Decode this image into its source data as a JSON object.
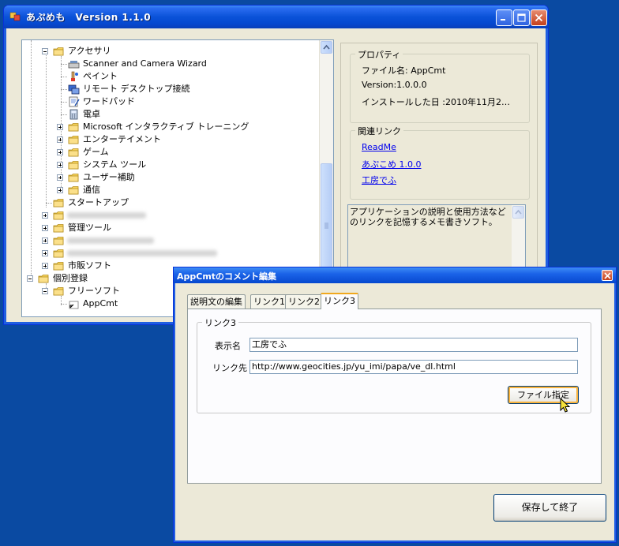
{
  "main_window": {
    "title": "あぷめも　Version 1.1.0",
    "tree": [
      {
        "label": "アクセサリ",
        "level": 1,
        "expander": "minus",
        "icon": "folder"
      },
      {
        "label": "Scanner and Camera Wizard",
        "level": 2,
        "expander": "none",
        "icon": "scanner"
      },
      {
        "label": "ペイント",
        "level": 2,
        "expander": "none",
        "icon": "paint"
      },
      {
        "label": "リモート デスクトップ接続",
        "level": 2,
        "expander": "none",
        "icon": "remote-desktop"
      },
      {
        "label": "ワードパッド",
        "level": 2,
        "expander": "none",
        "icon": "wordpad"
      },
      {
        "label": "電卓",
        "level": 2,
        "expander": "none",
        "icon": "calculator"
      },
      {
        "label": "Microsoft インタラクティブ トレーニング",
        "level": 2,
        "expander": "plus",
        "icon": "folder"
      },
      {
        "label": "エンターテイメント",
        "level": 2,
        "expander": "plus",
        "icon": "folder"
      },
      {
        "label": "ゲーム",
        "level": 2,
        "expander": "plus",
        "icon": "folder"
      },
      {
        "label": "システム ツール",
        "level": 2,
        "expander": "plus",
        "icon": "folder"
      },
      {
        "label": "ユーザー補助",
        "level": 2,
        "expander": "plus",
        "icon": "folder"
      },
      {
        "label": "通信",
        "level": 2,
        "expander": "plus",
        "icon": "folder"
      },
      {
        "label": "スタートアップ",
        "level": 1,
        "expander": "none",
        "icon": "folder"
      },
      {
        "label": "",
        "level": 1,
        "expander": "plus",
        "icon": "folder",
        "blurred": 100
      },
      {
        "label": "管理ツール",
        "level": 1,
        "expander": "plus",
        "icon": "folder"
      },
      {
        "label": "",
        "level": 1,
        "expander": "plus",
        "icon": "folder",
        "blurred": 110
      },
      {
        "label": "",
        "level": 1,
        "expander": "plus",
        "icon": "folder",
        "blurred": 190
      },
      {
        "label": "市販ソフト",
        "level": 1,
        "expander": "plus",
        "icon": "folder"
      },
      {
        "label": "個別登録",
        "level": 0,
        "expander": "minus",
        "icon": "folder"
      },
      {
        "label": "フリーソフト",
        "level": 1,
        "expander": "minus",
        "icon": "folder"
      },
      {
        "label": "AppCmt",
        "level": 2,
        "expander": "none",
        "icon": "shortcut"
      }
    ],
    "properties": {
      "legend": "プロパティ",
      "file_name": "ファイル名: AppCmt",
      "version": "Version:1.0.0.0",
      "install_date": "インストールした日 :2010年11月2…"
    },
    "links": {
      "legend": "関連リンク",
      "items": [
        "ReadMe",
        "あぷこめ 1.0.0",
        "工房でふ"
      ]
    },
    "description": "アプリケーションの説明と使用方法などのリンクを記憶するメモ書きソフト。"
  },
  "dialog": {
    "title": "AppCmtのコメント編集",
    "tabs": [
      "説明文の編集",
      "リンク1",
      "リンク2",
      "リンク3"
    ],
    "active_tab": 3,
    "group_legend": "リンク3",
    "display_name_label": "表示名",
    "display_name_value": "工房でふ",
    "link_label": "リンク先",
    "link_value": "http://www.geocities.jp/yu_imi/papa/ve_dl.html",
    "file_button": "ファイル指定",
    "save_button": "保存して終了"
  },
  "colors": {
    "desktop": "#0a4aa2",
    "titlebar": "#0648cf",
    "window_bg": "#ece9d8",
    "link": "#0000ee",
    "tab_highlight": "#f0a81e"
  }
}
